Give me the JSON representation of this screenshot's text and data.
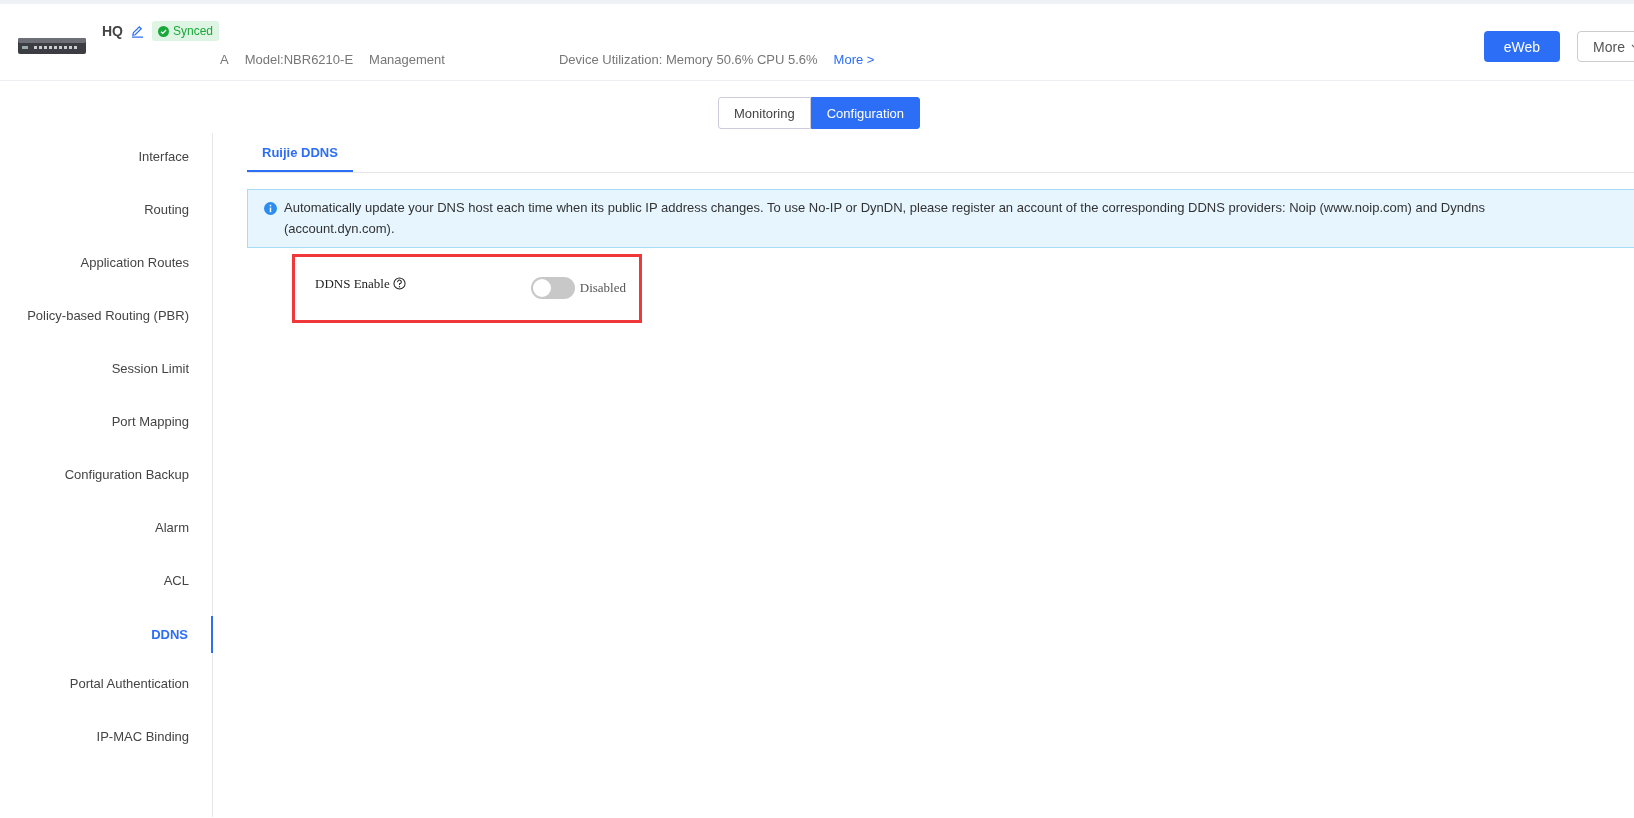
{
  "device": {
    "name": "HQ",
    "status": "Synced",
    "info": [
      "A",
      "Model:NBR6210-E",
      "Management"
    ],
    "utilization": "Device Utilization: Memory 50.6% CPU 5.6%",
    "more_link": "More >"
  },
  "header_buttons": [
    {
      "label": "eWeb",
      "kind": "primary"
    },
    {
      "label": "More",
      "kind": "dropdown"
    }
  ],
  "view_tabs": [
    {
      "label": "Monitoring",
      "selected": false
    },
    {
      "label": "Configuration",
      "selected": true
    }
  ],
  "sidebar": {
    "items": [
      {
        "label": "Interface",
        "selected": false
      },
      {
        "label": "Routing",
        "selected": false
      },
      {
        "label": "Application Routes",
        "selected": false
      },
      {
        "label": "Policy-based Routing (PBR)",
        "selected": false
      },
      {
        "label": "Session Limit",
        "selected": false
      },
      {
        "label": "Port Mapping",
        "selected": false
      },
      {
        "label": "Configuration Backup",
        "selected": false
      },
      {
        "label": "Alarm",
        "selected": false
      },
      {
        "label": "ACL",
        "selected": false
      },
      {
        "label": "DDNS",
        "selected": true
      },
      {
        "label": "Portal Authentication",
        "selected": false
      },
      {
        "label": "IP-MAC Binding",
        "selected": false
      }
    ]
  },
  "content_tabs": [
    {
      "label": "Ruijie DDNS",
      "selected": true
    }
  ],
  "notice": "Automatically update your DNS host each time when its public IP address changes. To use No-IP or DynDN, please register an account of the corresponding DDNS providers: Noip (www.noip.com) and Dyndns (account.dyn.com).",
  "ddns_setting": {
    "label": "DDNS Enable",
    "on": false,
    "status": "Disabled",
    "highlighted": true
  }
}
